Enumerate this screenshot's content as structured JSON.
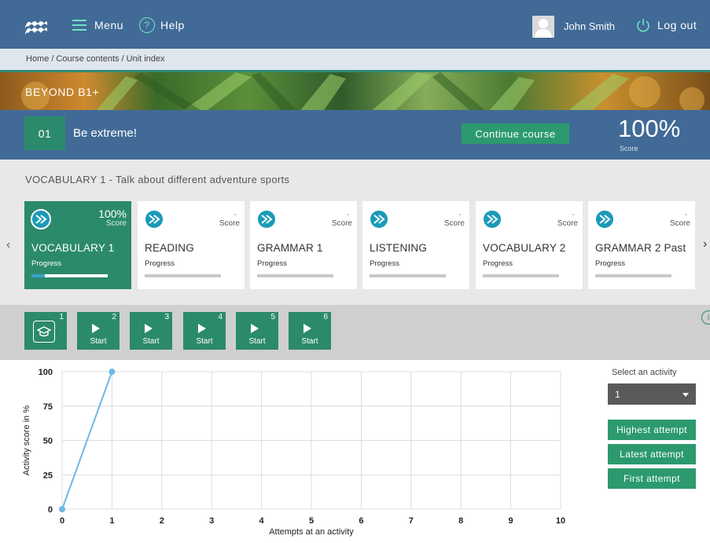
{
  "header": {
    "menu_label": "Menu",
    "help_label": "Help",
    "user_name": "John Smith",
    "logout_label": "Log out"
  },
  "breadcrumb": [
    "Home",
    "Course contents",
    "Unit index"
  ],
  "breadcrumb_separator": "/",
  "course": {
    "title": "BEYOND B1+"
  },
  "unit": {
    "number": "01",
    "title": "Be extreme!",
    "continue_label": "Continue course",
    "score": "100%",
    "score_label": "Score"
  },
  "section_title": "VOCABULARY 1  -  Talk about different adventure sports",
  "lessons": [
    {
      "name": "VOCABULARY 1",
      "score": "100%",
      "score_label": "Score",
      "progress_label": "Progress",
      "progress": 0.18,
      "active": true
    },
    {
      "name": "READING",
      "score": "-",
      "score_label": "Score",
      "progress_label": "Progress",
      "progress": 0,
      "active": false
    },
    {
      "name": "GRAMMAR 1",
      "score": "-",
      "score_label": "Score",
      "progress_label": "Progress",
      "progress": 0,
      "active": false
    },
    {
      "name": "LISTENING",
      "score": "-",
      "score_label": "Score",
      "progress_label": "Progress",
      "progress": 0,
      "active": false
    },
    {
      "name": "VOCABULARY 2",
      "score": "-",
      "score_label": "Score",
      "progress_label": "Progress",
      "progress": 0,
      "active": false
    },
    {
      "name": "GRAMMAR 2 Past",
      "score": "-",
      "score_label": "Score",
      "progress_label": "Progress",
      "progress": 0,
      "active": false
    }
  ],
  "activities": [
    {
      "number": "1",
      "label": "",
      "icon": "graduation-cap-icon"
    },
    {
      "number": "2",
      "label": "Start",
      "icon": "play-icon"
    },
    {
      "number": "3",
      "label": "Start",
      "icon": "play-icon"
    },
    {
      "number": "4",
      "label": "Start",
      "icon": "play-icon"
    },
    {
      "number": "5",
      "label": "Start",
      "icon": "play-icon"
    },
    {
      "number": "6",
      "label": "Start",
      "icon": "play-icon"
    }
  ],
  "side_panel": {
    "select_label": "Select an activity",
    "selected": "1",
    "highest_label": "Highest attempt",
    "latest_label": "Latest attempt",
    "first_label": "First attempt"
  },
  "colors": {
    "header_blue": "#416a96",
    "accent_green": "#2c9a6e",
    "line_blue": "#6cb9e3"
  },
  "chart_data": {
    "type": "line",
    "xlabel": "Attempts at an activity",
    "ylabel": "Activity score in %",
    "xlim": [
      0,
      10
    ],
    "ylim": [
      0,
      100
    ],
    "x_ticks": [
      0,
      1,
      2,
      3,
      4,
      5,
      6,
      7,
      8,
      9,
      10
    ],
    "y_ticks": [
      0,
      25,
      50,
      75,
      100
    ],
    "grid": true,
    "series": [
      {
        "x": [
          0,
          1
        ],
        "y": [
          0,
          100
        ]
      }
    ]
  }
}
